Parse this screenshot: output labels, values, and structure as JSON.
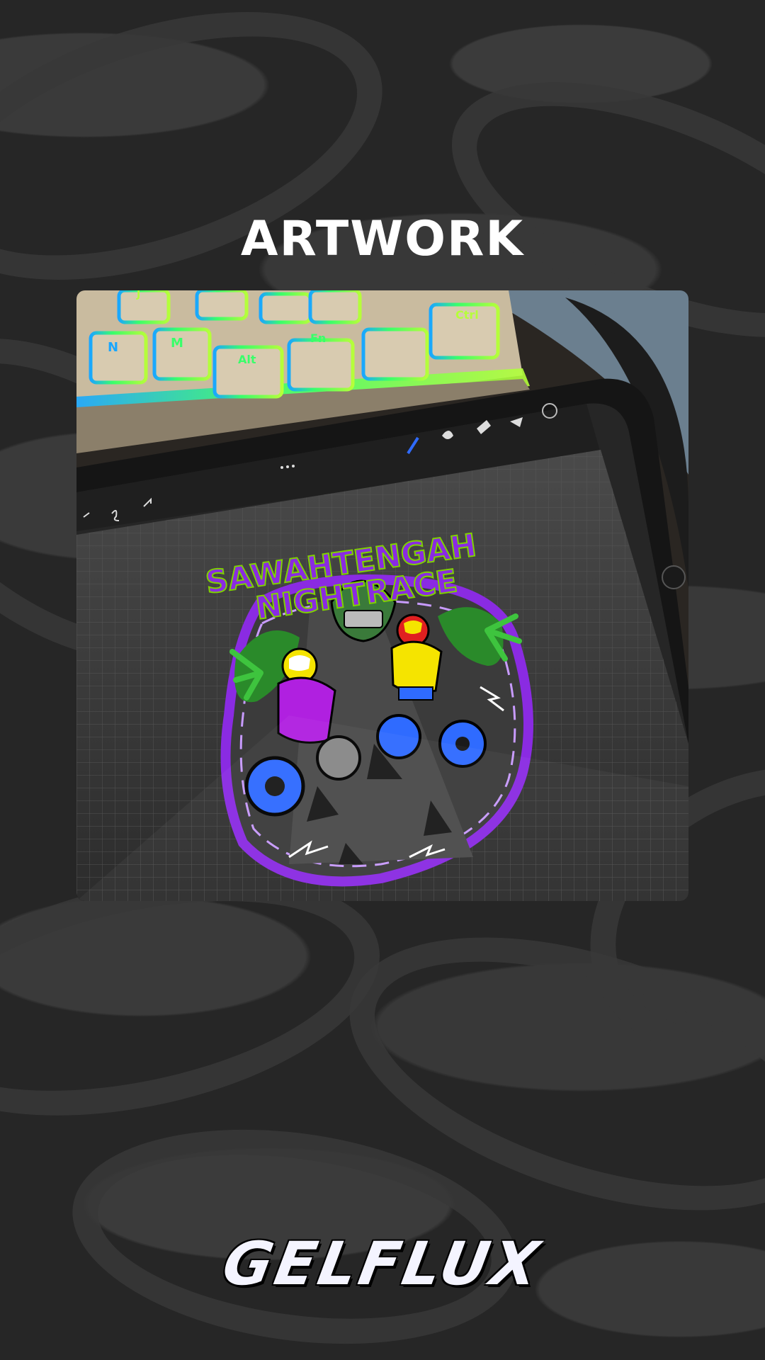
{
  "heading": "ARTWORK",
  "artwork": {
    "title_line1": "SAWAHTENGAH",
    "title_line2": "NIGHTRACE",
    "keys": [
      "N",
      "M",
      "Alt",
      "Fn",
      "Ctrl",
      "J"
    ],
    "colors": {
      "purple": "#8a2be2",
      "lime": "#7fd100",
      "yellow": "#f5e400",
      "red": "#e02020",
      "blue": "#2f6bff",
      "key_green": "#39ff6a",
      "key_blue": "#1aa7ff"
    }
  },
  "brand": "GELFLUX",
  "colors": {
    "background": "#262626",
    "swirl": "#383838",
    "text": "#ffffff"
  }
}
